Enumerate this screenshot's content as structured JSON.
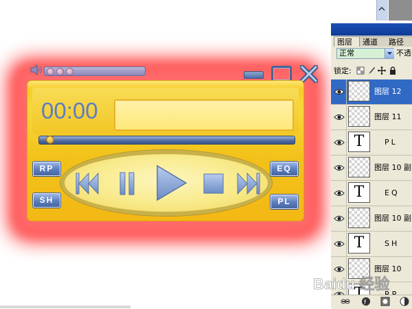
{
  "player": {
    "time": "00:00",
    "progress": 0.03,
    "volume_dots": 3,
    "buttons": {
      "rp": "RP",
      "sh": "SH",
      "eq": "EQ",
      "pl": "PL"
    },
    "transport_icons": [
      "rewind-icon",
      "pause-icon",
      "play-icon",
      "stop-icon",
      "fast-forward-icon"
    ]
  },
  "layers_panel": {
    "tabs": [
      "图层",
      "通道",
      "路径"
    ],
    "blend_mode": "正常",
    "opacity_label": "不透",
    "lock_label": "锁定:",
    "rows": [
      {
        "name": "图层 12",
        "type": "raster",
        "selected": true
      },
      {
        "name": "图层 11",
        "type": "raster",
        "selected": false
      },
      {
        "name": "PL",
        "type": "text",
        "selected": false
      },
      {
        "name": "图层 10 副",
        "type": "raster",
        "selected": false
      },
      {
        "name": "EQ",
        "type": "text",
        "selected": false
      },
      {
        "name": "图层 10 副",
        "type": "raster",
        "selected": false
      },
      {
        "name": "SH",
        "type": "text",
        "selected": false
      },
      {
        "name": "图层 10",
        "type": "raster",
        "selected": false
      },
      {
        "name": "RP",
        "type": "text",
        "selected": false
      }
    ],
    "text_layer_glyph": "T"
  },
  "watermark": {
    "text": "Baidu 经验"
  },
  "colors": {
    "glow": "#ff2a2a",
    "panel": "#f4c91e",
    "button_blue": "#5a7dbd",
    "time_text": "#5c7cc4",
    "selection": "#316ac5"
  }
}
